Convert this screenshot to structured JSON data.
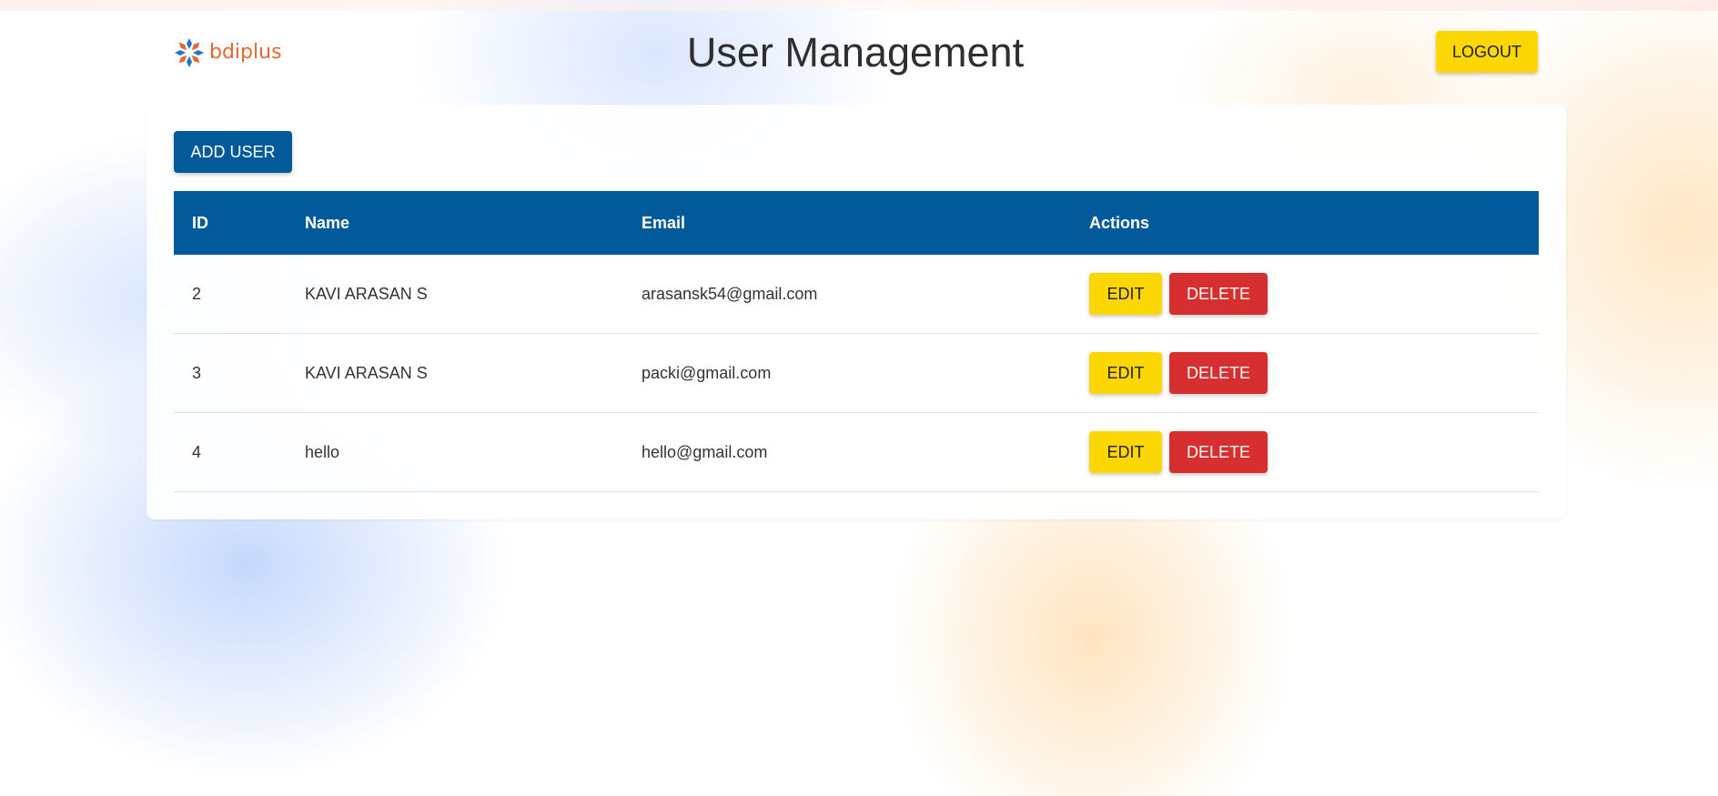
{
  "header": {
    "logo_text": "bdiplus",
    "title": "User Management",
    "logout_label": "LOGOUT"
  },
  "toolbar": {
    "add_user_label": "ADD USER"
  },
  "table": {
    "columns": [
      "ID",
      "Name",
      "Email",
      "Actions"
    ],
    "rows": [
      {
        "id": "2",
        "name": "KAVI ARASAN S",
        "email": "arasansk54@gmail.com",
        "edit_label": "EDIT",
        "delete_label": "DELETE"
      },
      {
        "id": "3",
        "name": "KAVI ARASAN S",
        "email": "packi@gmail.com",
        "edit_label": "EDIT",
        "delete_label": "DELETE"
      },
      {
        "id": "4",
        "name": "hello",
        "email": "hello@gmail.com",
        "edit_label": "EDIT",
        "delete_label": "DELETE"
      }
    ]
  },
  "colors": {
    "primary": "#035a9b",
    "accent_yellow": "#fdd704",
    "danger_red": "#d72f2f",
    "logo_orange": "#e8662f",
    "logo_blue": "#1c74d6"
  },
  "icons": {
    "logo": "snowflake-logo-icon"
  }
}
